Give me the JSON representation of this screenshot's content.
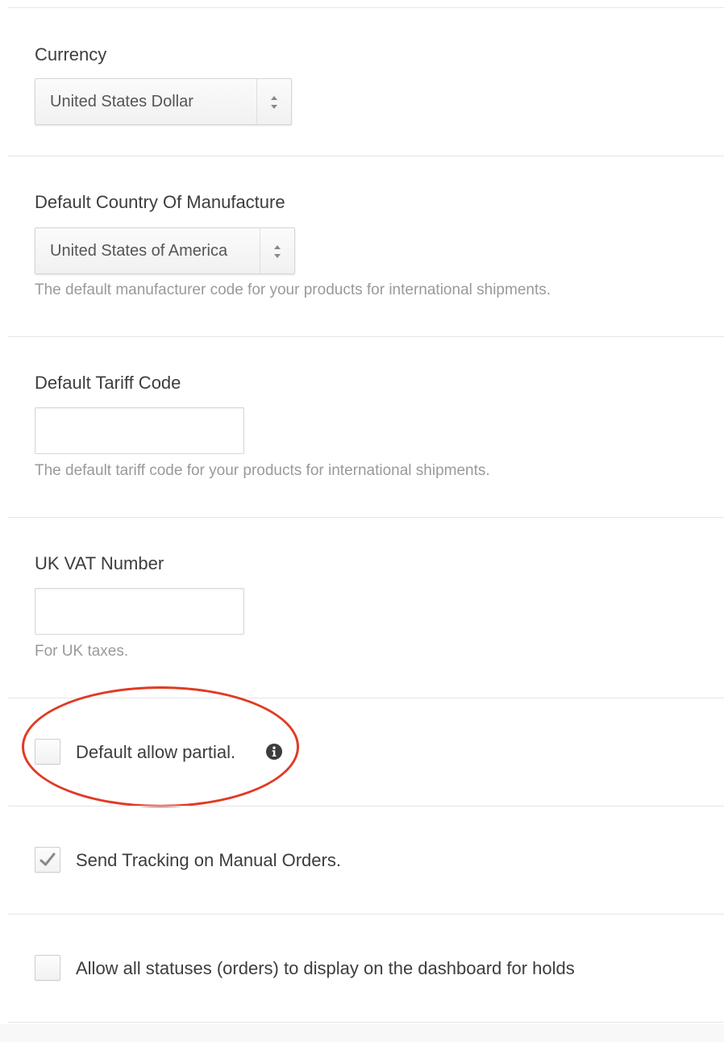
{
  "currency": {
    "label": "Currency",
    "selected": "United States Dollar"
  },
  "country_of_manufacture": {
    "label": "Default Country Of Manufacture",
    "selected": "United States of America",
    "help": "The default manufacturer code for your products for international shipments."
  },
  "tariff_code": {
    "label": "Default Tariff Code",
    "value": "",
    "help": "The default tariff code for your products for international shipments."
  },
  "uk_vat": {
    "label": "UK VAT Number",
    "value": "",
    "help": "For UK taxes."
  },
  "allow_partial": {
    "label": "Default allow partial.",
    "checked": false,
    "icon": "info-icon"
  },
  "send_tracking": {
    "label": "Send Tracking on Manual Orders.",
    "checked": true
  },
  "allow_all_statuses": {
    "label": "Allow all statuses (orders) to display on the dashboard for holds",
    "checked": false
  },
  "colors": {
    "annotation": "#e03b24",
    "text": "#3d3d3d",
    "help_text": "#9a9a9a",
    "divider": "#e6e6e6"
  }
}
